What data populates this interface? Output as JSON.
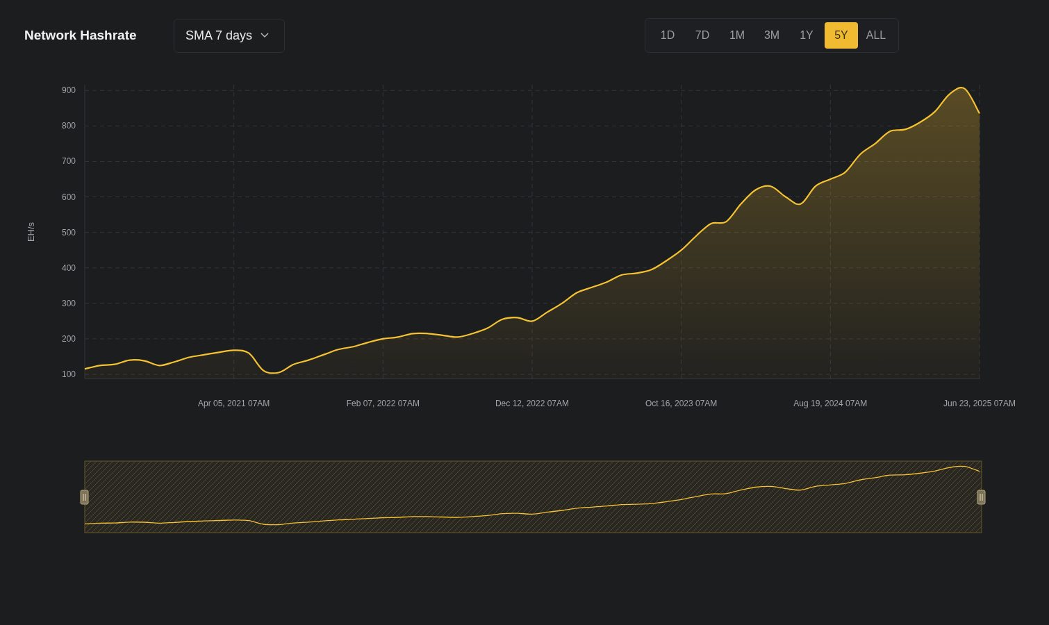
{
  "title": "Network Hashrate",
  "smoothing": {
    "value": "SMA 7 days"
  },
  "ranges": [
    {
      "label": "1D",
      "selected": false
    },
    {
      "label": "7D",
      "selected": false
    },
    {
      "label": "1M",
      "selected": false
    },
    {
      "label": "3M",
      "selected": false
    },
    {
      "label": "1Y",
      "selected": false
    },
    {
      "label": "5Y",
      "selected": true
    },
    {
      "label": "ALL",
      "selected": false
    }
  ],
  "chart": {
    "chart_data": {
      "type": "area",
      "ylabel": "EH/s",
      "categories": [
        null,
        null,
        null,
        null,
        null,
        null,
        null,
        null,
        null,
        null,
        "Apr 05, 2021 07AM",
        null,
        null,
        null,
        null,
        null,
        null,
        null,
        null,
        null,
        "Feb 07, 2022 07AM",
        null,
        null,
        null,
        null,
        null,
        null,
        null,
        null,
        null,
        "Dec 12, 2022 07AM",
        null,
        null,
        null,
        null,
        null,
        null,
        null,
        null,
        null,
        "Oct 16, 2023 07AM",
        null,
        null,
        null,
        null,
        null,
        null,
        null,
        null,
        null,
        "Aug 19, 2024 07AM",
        null,
        null,
        null,
        null,
        null,
        null,
        null,
        null,
        null,
        "Jun 23, 2025 07AM"
      ],
      "series": [
        {
          "color": "#f5c232",
          "values": [
            115,
            125,
            128,
            140,
            138,
            125,
            135,
            148,
            155,
            162,
            168,
            160,
            110,
            105,
            128,
            140,
            155,
            170,
            178,
            190,
            200,
            205,
            215,
            215,
            210,
            205,
            215,
            230,
            255,
            260,
            250,
            275,
            300,
            330,
            345,
            360,
            380,
            385,
            395,
            420,
            450,
            490,
            525,
            530,
            580,
            620,
            630,
            600,
            580,
            630,
            650,
            670,
            720,
            750,
            785,
            790,
            810,
            840,
            890,
            905,
            835
          ]
        }
      ],
      "ylim": [
        95,
        920
      ],
      "grid": true,
      "yticks": [
        100,
        200,
        300,
        400,
        500,
        600,
        700,
        800,
        900
      ]
    }
  }
}
